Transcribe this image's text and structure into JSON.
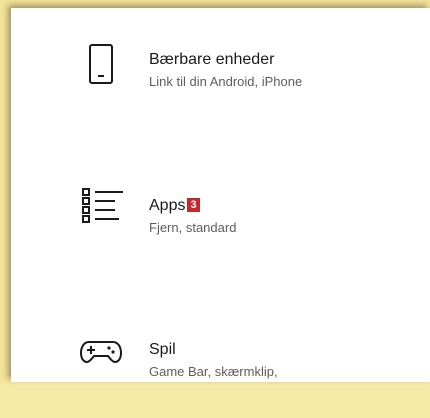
{
  "items": [
    {
      "title": "Bærbare enheder",
      "subtitle": "Link til din Android, iPhone",
      "icon": "phone-icon"
    },
    {
      "title": "Apps",
      "badge": "3",
      "subtitle": "Fjern, standard",
      "icon": "apps-list-icon"
    },
    {
      "title": "Spil",
      "subtitle": "Game Bar, skærmklip,",
      "icon": "gamepad-icon"
    }
  ],
  "colors": {
    "badge": "#c4282d",
    "highlight_border": "#f3e49a",
    "panel": "#ffffff"
  }
}
